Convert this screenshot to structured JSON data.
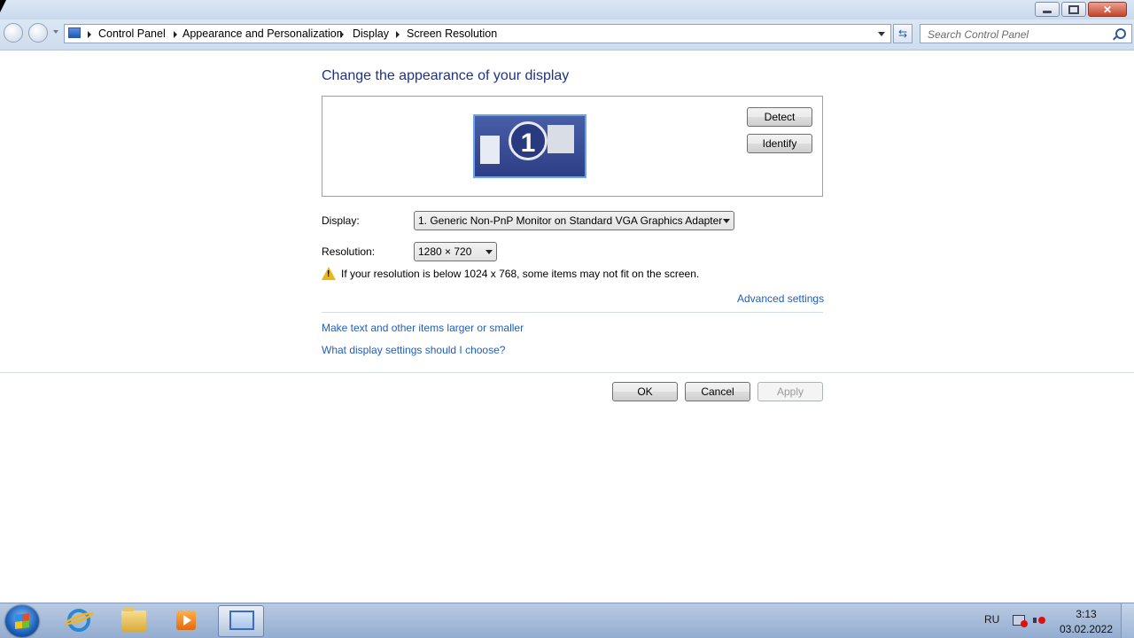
{
  "window": {
    "controls": {
      "minimize": "–",
      "maximize": "❐",
      "close": "✕"
    }
  },
  "address_bar": {
    "breadcrumbs": [
      "Control Panel",
      "Appearance and Personalization",
      "Display",
      "Screen Resolution"
    ],
    "search_placeholder": "Search Control Panel"
  },
  "main": {
    "heading": "Change the appearance of your display",
    "monitor_number": "1",
    "detect_label": "Detect",
    "identify_label": "Identify",
    "display_label": "Display:",
    "display_value": "1. Generic Non-PnP Monitor on Standard VGA Graphics Adapter",
    "resolution_label": "Resolution:",
    "resolution_value": "1280 × 720",
    "warning_text": "If your resolution is below 1024 x 768, some items may not fit on the screen.",
    "advanced_settings": "Advanced settings",
    "link_text_size": "Make text and other items larger or smaller",
    "link_help": "What display settings should I choose?"
  },
  "footer_buttons": {
    "ok": "OK",
    "cancel": "Cancel",
    "apply": "Apply",
    "apply_enabled": false
  },
  "taskbar": {
    "items": [
      "start-orb",
      "internet-explorer-icon",
      "windows-explorer-icon",
      "media-player-icon",
      "control-panel-icon"
    ],
    "active_item": "control-panel-icon",
    "tray": {
      "language": "RU",
      "time": "3:13",
      "date": "03.02.2022"
    }
  },
  "colors": {
    "heading": "#1e3287",
    "link": "#1f5ebd",
    "warning": "#e8b71c",
    "taskbar": "#93acd0"
  }
}
